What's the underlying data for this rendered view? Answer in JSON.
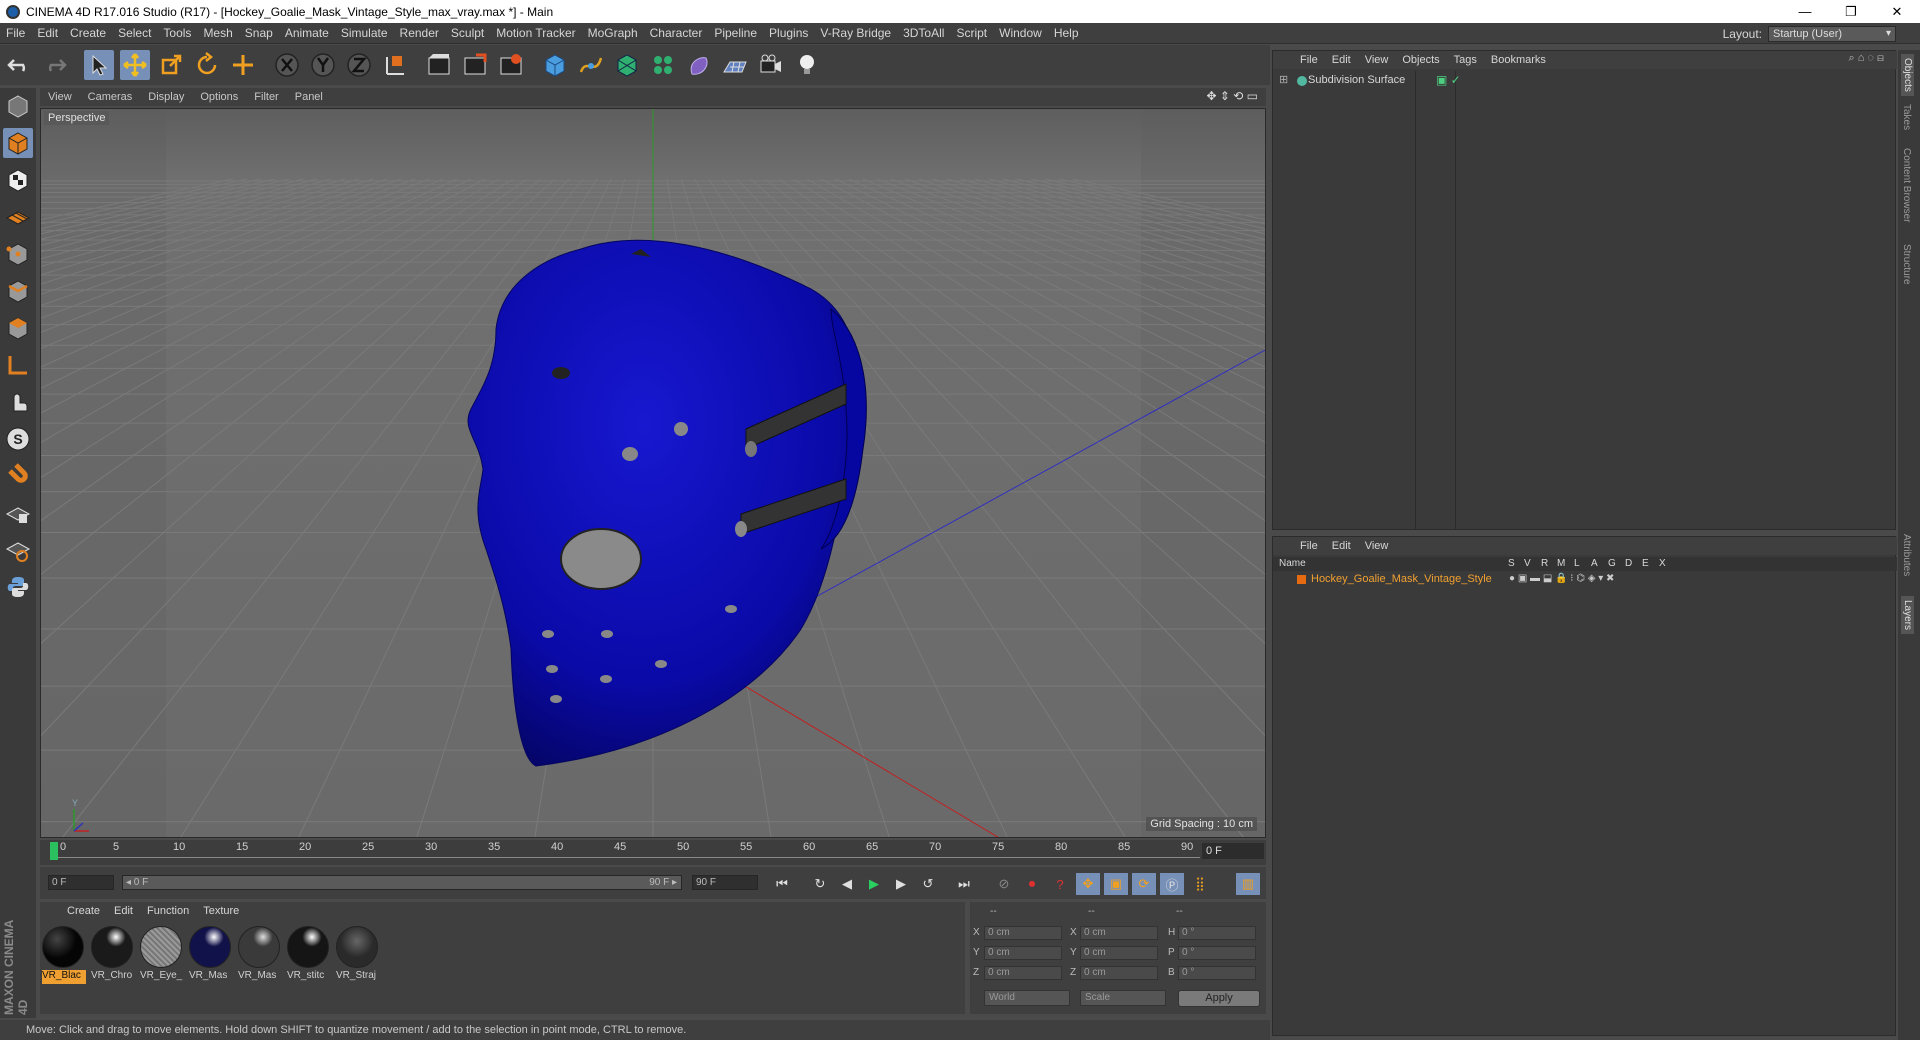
{
  "window": {
    "title": "CINEMA 4D R17.016 Studio (R17) - [Hockey_Goalie_Mask_Vintage_Style_max_vray.max *] - Main",
    "controls": [
      "—",
      "❐",
      "✕"
    ]
  },
  "menubar": {
    "items": [
      "File",
      "Edit",
      "Create",
      "Select",
      "Tools",
      "Mesh",
      "Snap",
      "Animate",
      "Simulate",
      "Render",
      "Sculpt",
      "Motion Tracker",
      "MoGraph",
      "Character",
      "Pipeline",
      "Plugins",
      "V-Ray Bridge",
      "3DToAll",
      "Script",
      "Window",
      "Help"
    ],
    "layout_label": "Layout:",
    "layout_value": "Startup (User)"
  },
  "toolbar": {
    "icons": [
      "undo-icon",
      "redo-icon",
      "select-cursor-icon",
      "move-icon",
      "scale-icon",
      "rotate-icon",
      "live-select-icon",
      "x-axis-icon",
      "y-axis-icon",
      "z-axis-icon",
      "coordinate-system-icon",
      "render-view-icon",
      "render-picture-icon",
      "render-settings-icon",
      "cube-icon",
      "pen-spline-icon",
      "subdivision-icon",
      "cloner-icon",
      "deformer-icon",
      "floor-icon",
      "camera-icon",
      "light-icon"
    ]
  },
  "left_tools": {
    "icons": [
      "make-editable-icon",
      "model-mode-icon",
      "texture-mode-icon",
      "workplane-icon",
      "points-mode-icon",
      "edges-mode-icon",
      "polygons-mode-icon",
      "axis-mode-icon",
      "tweak-icon",
      "solo-icon",
      "magnet-icon",
      "snap-grid-icon",
      "snap-settings-icon",
      "python-icon"
    ]
  },
  "viewport": {
    "menu": [
      "View",
      "Cameras",
      "Display",
      "Options",
      "Filter",
      "Panel"
    ],
    "label": "Perspective",
    "grid_spacing": "Grid Spacing : 10 cm",
    "axis_y": "Y"
  },
  "timeline": {
    "ticks": [
      "0",
      "5",
      "10",
      "15",
      "20",
      "25",
      "30",
      "35",
      "40",
      "45",
      "50",
      "55",
      "60",
      "65",
      "70",
      "75",
      "80",
      "85",
      "90"
    ],
    "current_frame": "0 F"
  },
  "playbar": {
    "start_field": "0 F",
    "range_start": "◂ 0 F",
    "range_end": "90 F ▸",
    "end_field": "90 F"
  },
  "materials": {
    "menu": [
      "Create",
      "Edit",
      "Function",
      "Texture"
    ],
    "items": [
      {
        "name": "VR_Blac",
        "color": "#050505"
      },
      {
        "name": "VR_Chro",
        "color": "#1a1a1a"
      },
      {
        "name": "VR_Eye_",
        "color": "#9a9a9a"
      },
      {
        "name": "VR_Mas",
        "color": "#12124a"
      },
      {
        "name": "VR_Mas",
        "color": "#3a3a3a"
      },
      {
        "name": "VR_stitc",
        "color": "#151515"
      },
      {
        "name": "VR_Straj",
        "color": "#2a2a2a"
      }
    ]
  },
  "coordinates": {
    "headers": [
      "--",
      "--",
      "--"
    ],
    "rows": [
      {
        "a": "X",
        "av": "0 cm",
        "b": "X",
        "bv": "0 cm",
        "c": "H",
        "cv": "0 °"
      },
      {
        "a": "Y",
        "av": "0 cm",
        "b": "Y",
        "bv": "0 cm",
        "c": "P",
        "cv": "0 °"
      },
      {
        "a": "Z",
        "av": "0 cm",
        "b": "Z",
        "bv": "0 cm",
        "c": "B",
        "cv": "0 °"
      }
    ],
    "mode": "World",
    "scale": "Scale",
    "apply": "Apply"
  },
  "object_manager": {
    "menu": [
      "File",
      "Edit",
      "View",
      "Objects",
      "Tags",
      "Bookmarks"
    ],
    "object": "Subdivision Surface"
  },
  "layer_manager": {
    "menu": [
      "File",
      "Edit",
      "View"
    ],
    "columns": [
      "Name",
      "S",
      "V",
      "R",
      "M",
      "L",
      "A",
      "G",
      "D",
      "E",
      "X"
    ],
    "layer": "Hockey_Goalie_Mask_Vintage_Style",
    "layer_color": "#e56a10"
  },
  "right_tabs": [
    "Objects",
    "Takes",
    "Content Browser",
    "Structure",
    "Attributes",
    "Layers"
  ],
  "status": "Move: Click and drag to move elements. Hold down SHIFT to quantize movement / add to the selection in point mode, CTRL to remove.",
  "brand": "MAXON CINEMA 4D",
  "colors": {
    "accent": "#7690b8",
    "mask_blue": "#0a0ab0",
    "active_material": "#f0a030"
  }
}
